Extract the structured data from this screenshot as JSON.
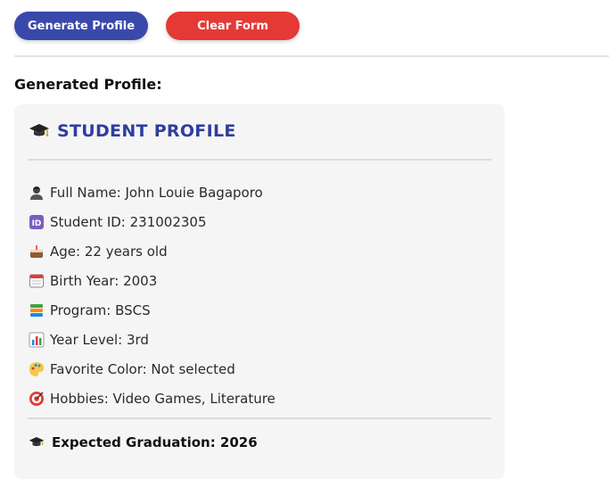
{
  "toolbar": {
    "generate_label": "Generate Profile",
    "clear_label": "Clear Form",
    "colors": {
      "primary": "#3949ab",
      "danger": "#e53935"
    }
  },
  "output": {
    "heading": "Generated Profile:"
  },
  "profile": {
    "title": "STUDENT PROFILE",
    "title_icon": "graduation-cap-icon",
    "fields": [
      {
        "icon": "person-icon",
        "text": "Full Name: John Louie Bagaporo"
      },
      {
        "icon": "id-badge-icon",
        "text": "Student ID: 231002305"
      },
      {
        "icon": "cake-icon",
        "text": "Age: 22 years old"
      },
      {
        "icon": "calendar-icon",
        "text": "Birth Year: 2003"
      },
      {
        "icon": "books-icon",
        "text": "Program: BSCS"
      },
      {
        "icon": "bar-chart-icon",
        "text": "Year Level: 3rd"
      },
      {
        "icon": "palette-icon",
        "text": "Favorite Color: Not selected"
      },
      {
        "icon": "target-icon",
        "text": "Hobbies: Video Games, Literature"
      }
    ],
    "graduation": "Expected Graduation: 2026",
    "graduation_icon": "graduation-cap-icon"
  }
}
